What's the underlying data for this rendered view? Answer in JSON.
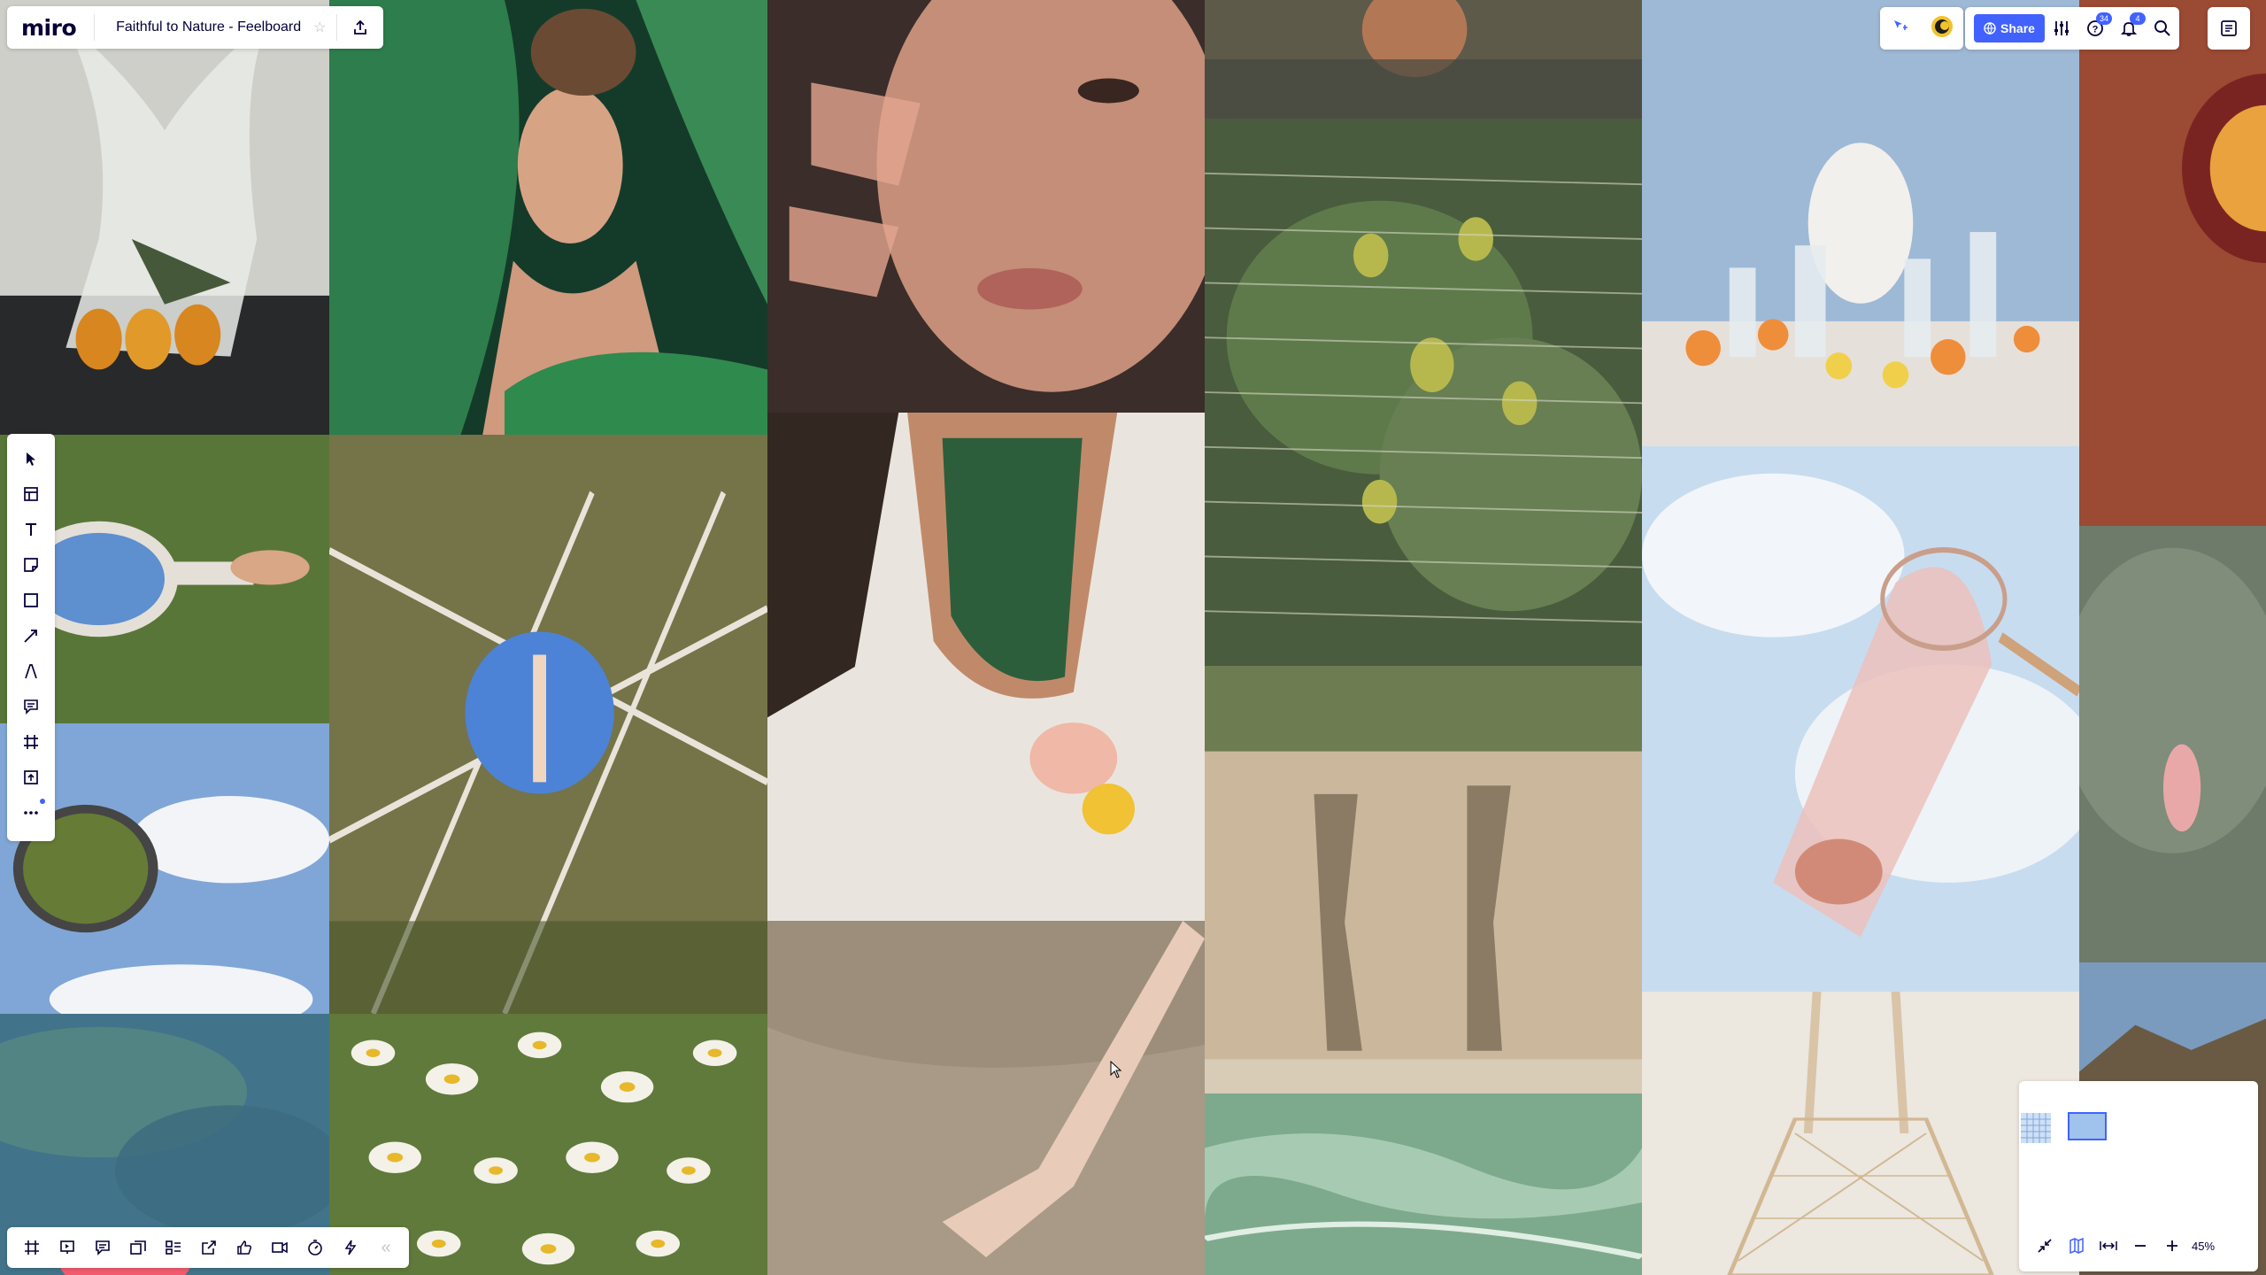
{
  "app": {
    "logo": "miro",
    "board_title": "Faithful to Nature - Feelboard"
  },
  "topbar": {
    "share_label": "Share",
    "help_badge": "34",
    "notifications_badge": "4"
  },
  "left_toolbar": {
    "tools": [
      "select",
      "templates",
      "text",
      "sticky-note",
      "shape",
      "pen-line",
      "pen",
      "comment",
      "frame",
      "upload",
      "more"
    ]
  },
  "bottom_toolbar": {
    "tools": [
      "frames",
      "presentation",
      "comments",
      "cards",
      "kanban",
      "share-screen",
      "voting",
      "video-call",
      "timer",
      "lightning",
      "collapse"
    ]
  },
  "navigator": {
    "zoom": "45%"
  },
  "board_images": [
    "Plastic bag with oranges",
    "Woman with palm leaf",
    "Face close-up with hand shadow",
    "Bather in water",
    "Apple tree behind netting",
    "Table with vases and citrus",
    "Hand holding mirror on grass",
    "Round mirror in tree branches",
    "Green polka swimsuit on sand with grapefruit",
    "Mirror reflecting grass against sky",
    "Shadows on canvas sheet",
    "Pink butterfly net in sky",
    "Red flower behind glass",
    "Sea and mountains",
    "Chamomile flowers",
    "Hand over wet sand",
    "Green plastic wrap",
    "Mesh bag",
    "Cloudy glass with fruit",
    "Pomegranate edge"
  ],
  "colors": {
    "accent": "#4262ff",
    "ink": "#050038"
  }
}
